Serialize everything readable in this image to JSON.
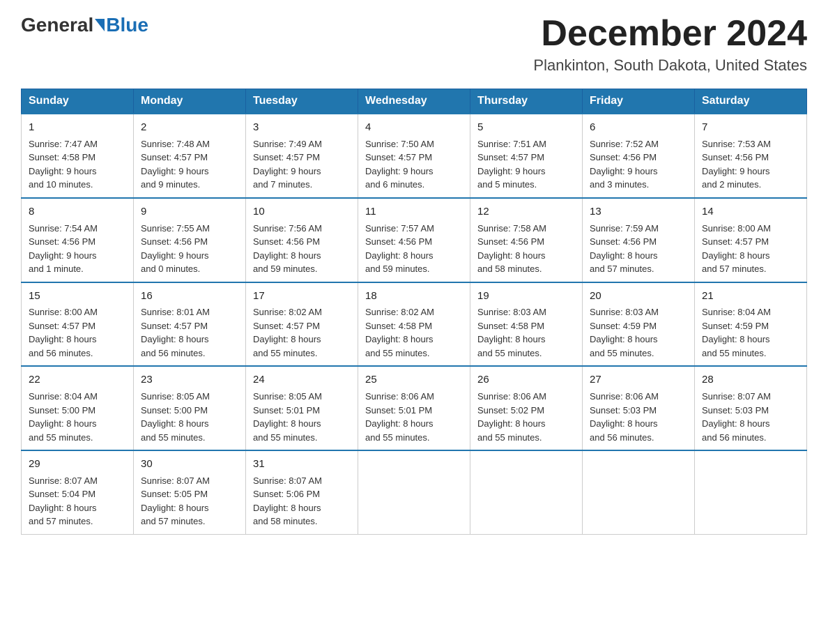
{
  "logo": {
    "general": "General",
    "blue": "Blue"
  },
  "title": "December 2024",
  "location": "Plankinton, South Dakota, United States",
  "days_of_week": [
    "Sunday",
    "Monday",
    "Tuesday",
    "Wednesday",
    "Thursday",
    "Friday",
    "Saturday"
  ],
  "weeks": [
    [
      {
        "num": "1",
        "sunrise": "7:47 AM",
        "sunset": "4:58 PM",
        "daylight": "9 hours and 10 minutes."
      },
      {
        "num": "2",
        "sunrise": "7:48 AM",
        "sunset": "4:57 PM",
        "daylight": "9 hours and 9 minutes."
      },
      {
        "num": "3",
        "sunrise": "7:49 AM",
        "sunset": "4:57 PM",
        "daylight": "9 hours and 7 minutes."
      },
      {
        "num": "4",
        "sunrise": "7:50 AM",
        "sunset": "4:57 PM",
        "daylight": "9 hours and 6 minutes."
      },
      {
        "num": "5",
        "sunrise": "7:51 AM",
        "sunset": "4:57 PM",
        "daylight": "9 hours and 5 minutes."
      },
      {
        "num": "6",
        "sunrise": "7:52 AM",
        "sunset": "4:56 PM",
        "daylight": "9 hours and 3 minutes."
      },
      {
        "num": "7",
        "sunrise": "7:53 AM",
        "sunset": "4:56 PM",
        "daylight": "9 hours and 2 minutes."
      }
    ],
    [
      {
        "num": "8",
        "sunrise": "7:54 AM",
        "sunset": "4:56 PM",
        "daylight": "9 hours and 1 minute."
      },
      {
        "num": "9",
        "sunrise": "7:55 AM",
        "sunset": "4:56 PM",
        "daylight": "9 hours and 0 minutes."
      },
      {
        "num": "10",
        "sunrise": "7:56 AM",
        "sunset": "4:56 PM",
        "daylight": "8 hours and 59 minutes."
      },
      {
        "num": "11",
        "sunrise": "7:57 AM",
        "sunset": "4:56 PM",
        "daylight": "8 hours and 59 minutes."
      },
      {
        "num": "12",
        "sunrise": "7:58 AM",
        "sunset": "4:56 PM",
        "daylight": "8 hours and 58 minutes."
      },
      {
        "num": "13",
        "sunrise": "7:59 AM",
        "sunset": "4:56 PM",
        "daylight": "8 hours and 57 minutes."
      },
      {
        "num": "14",
        "sunrise": "8:00 AM",
        "sunset": "4:57 PM",
        "daylight": "8 hours and 57 minutes."
      }
    ],
    [
      {
        "num": "15",
        "sunrise": "8:00 AM",
        "sunset": "4:57 PM",
        "daylight": "8 hours and 56 minutes."
      },
      {
        "num": "16",
        "sunrise": "8:01 AM",
        "sunset": "4:57 PM",
        "daylight": "8 hours and 56 minutes."
      },
      {
        "num": "17",
        "sunrise": "8:02 AM",
        "sunset": "4:57 PM",
        "daylight": "8 hours and 55 minutes."
      },
      {
        "num": "18",
        "sunrise": "8:02 AM",
        "sunset": "4:58 PM",
        "daylight": "8 hours and 55 minutes."
      },
      {
        "num": "19",
        "sunrise": "8:03 AM",
        "sunset": "4:58 PM",
        "daylight": "8 hours and 55 minutes."
      },
      {
        "num": "20",
        "sunrise": "8:03 AM",
        "sunset": "4:59 PM",
        "daylight": "8 hours and 55 minutes."
      },
      {
        "num": "21",
        "sunrise": "8:04 AM",
        "sunset": "4:59 PM",
        "daylight": "8 hours and 55 minutes."
      }
    ],
    [
      {
        "num": "22",
        "sunrise": "8:04 AM",
        "sunset": "5:00 PM",
        "daylight": "8 hours and 55 minutes."
      },
      {
        "num": "23",
        "sunrise": "8:05 AM",
        "sunset": "5:00 PM",
        "daylight": "8 hours and 55 minutes."
      },
      {
        "num": "24",
        "sunrise": "8:05 AM",
        "sunset": "5:01 PM",
        "daylight": "8 hours and 55 minutes."
      },
      {
        "num": "25",
        "sunrise": "8:06 AM",
        "sunset": "5:01 PM",
        "daylight": "8 hours and 55 minutes."
      },
      {
        "num": "26",
        "sunrise": "8:06 AM",
        "sunset": "5:02 PM",
        "daylight": "8 hours and 55 minutes."
      },
      {
        "num": "27",
        "sunrise": "8:06 AM",
        "sunset": "5:03 PM",
        "daylight": "8 hours and 56 minutes."
      },
      {
        "num": "28",
        "sunrise": "8:07 AM",
        "sunset": "5:03 PM",
        "daylight": "8 hours and 56 minutes."
      }
    ],
    [
      {
        "num": "29",
        "sunrise": "8:07 AM",
        "sunset": "5:04 PM",
        "daylight": "8 hours and 57 minutes."
      },
      {
        "num": "30",
        "sunrise": "8:07 AM",
        "sunset": "5:05 PM",
        "daylight": "8 hours and 57 minutes."
      },
      {
        "num": "31",
        "sunrise": "8:07 AM",
        "sunset": "5:06 PM",
        "daylight": "8 hours and 58 minutes."
      },
      null,
      null,
      null,
      null
    ]
  ],
  "labels": {
    "sunrise": "Sunrise:",
    "sunset": "Sunset:",
    "daylight": "Daylight:"
  }
}
